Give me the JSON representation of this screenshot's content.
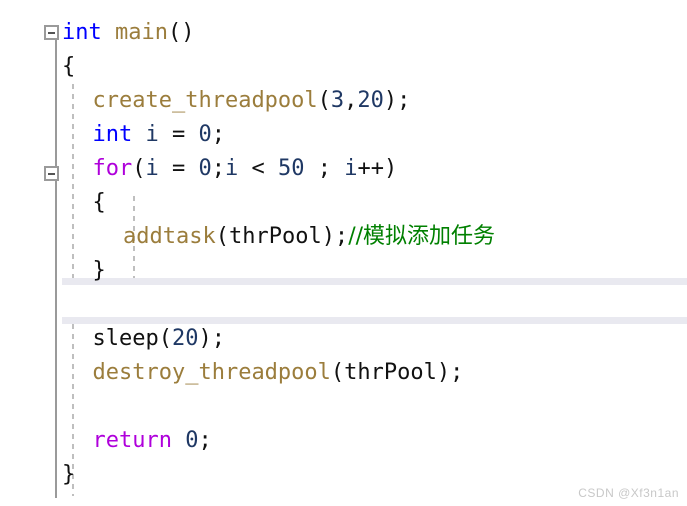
{
  "editor": {
    "language": "C",
    "background": "#ffffff",
    "font_size_px": 22,
    "line_height_px": 34
  },
  "colors": {
    "keyword": "#0000ff",
    "control": "#af00db",
    "function": "#9b7d3c",
    "variable": "#1f3864",
    "number": "#1f3864",
    "punctuation": "#111111",
    "comment": "#008000",
    "gutter_line": "#9a9a9a",
    "indent_guide": "#bfbfbf",
    "current_line_border": "#e9e9f0",
    "watermark": "#c8c8c8"
  },
  "fold_markers": [
    {
      "name": "fold-main",
      "line": 0,
      "state": "expanded",
      "glyph": "minus"
    },
    {
      "name": "fold-for",
      "line": 4,
      "state": "expanded",
      "glyph": "minus"
    }
  ],
  "current_line_index": 8,
  "lines": [
    {
      "index": 0,
      "text": "int main()",
      "tokens": [
        {
          "t": "int",
          "c": "kw"
        },
        {
          "t": " ",
          "c": "plain"
        },
        {
          "t": "main",
          "c": "fn"
        },
        {
          "t": "()",
          "c": "punct"
        }
      ]
    },
    {
      "index": 1,
      "text": "{",
      "tokens": [
        {
          "t": "{",
          "c": "punct"
        }
      ]
    },
    {
      "index": 2,
      "text": "    create_threadpool(3,20);",
      "tokens": [
        {
          "t": "create_threadpool",
          "c": "fn"
        },
        {
          "t": "(",
          "c": "punct"
        },
        {
          "t": "3",
          "c": "num"
        },
        {
          "t": ",",
          "c": "punct"
        },
        {
          "t": "20",
          "c": "num"
        },
        {
          "t": ");",
          "c": "punct"
        }
      ]
    },
    {
      "index": 3,
      "text": "    int i = 0;",
      "tokens": [
        {
          "t": "int",
          "c": "kw"
        },
        {
          "t": " ",
          "c": "plain"
        },
        {
          "t": "i",
          "c": "var"
        },
        {
          "t": " = ",
          "c": "punct"
        },
        {
          "t": "0",
          "c": "num"
        },
        {
          "t": ";",
          "c": "punct"
        }
      ]
    },
    {
      "index": 4,
      "text": "    for(i = 0;i < 50 ; i++)",
      "tokens": [
        {
          "t": "for",
          "c": "ctrl"
        },
        {
          "t": "(",
          "c": "punct"
        },
        {
          "t": "i",
          "c": "var"
        },
        {
          "t": " = ",
          "c": "punct"
        },
        {
          "t": "0",
          "c": "num"
        },
        {
          "t": ";",
          "c": "punct"
        },
        {
          "t": "i",
          "c": "var"
        },
        {
          "t": " < ",
          "c": "punct"
        },
        {
          "t": "50",
          "c": "num"
        },
        {
          "t": " ; ",
          "c": "punct"
        },
        {
          "t": "i",
          "c": "var"
        },
        {
          "t": "++)",
          "c": "punct"
        }
      ]
    },
    {
      "index": 5,
      "text": "    {",
      "tokens": [
        {
          "t": "{",
          "c": "punct"
        }
      ]
    },
    {
      "index": 6,
      "text": "        addtask(thrPool);//模拟添加任务",
      "tokens": [
        {
          "t": "addtask",
          "c": "fn"
        },
        {
          "t": "(",
          "c": "punct"
        },
        {
          "t": "thrPool",
          "c": "plain"
        },
        {
          "t": ");",
          "c": "punct"
        },
        {
          "t": "//模拟添加任务",
          "c": "comment"
        }
      ]
    },
    {
      "index": 7,
      "text": "    }",
      "tokens": [
        {
          "t": "}",
          "c": "punct"
        }
      ]
    },
    {
      "index": 8,
      "text": "",
      "tokens": []
    },
    {
      "index": 9,
      "text": "    sleep(20);",
      "tokens": [
        {
          "t": "sleep",
          "c": "plain"
        },
        {
          "t": "(",
          "c": "punct"
        },
        {
          "t": "20",
          "c": "num"
        },
        {
          "t": ");",
          "c": "punct"
        }
      ]
    },
    {
      "index": 10,
      "text": "    destroy_threadpool(thrPool);",
      "tokens": [
        {
          "t": "destroy_threadpool",
          "c": "fn"
        },
        {
          "t": "(",
          "c": "punct"
        },
        {
          "t": "thrPool",
          "c": "plain"
        },
        {
          "t": ");",
          "c": "punct"
        }
      ]
    },
    {
      "index": 11,
      "text": "",
      "tokens": []
    },
    {
      "index": 12,
      "text": "    return 0;",
      "tokens": [
        {
          "t": "return",
          "c": "ctrl"
        },
        {
          "t": " ",
          "c": "plain"
        },
        {
          "t": "0",
          "c": "num"
        },
        {
          "t": ";",
          "c": "punct"
        }
      ]
    },
    {
      "index": 13,
      "text": "}",
      "tokens": [
        {
          "t": "}",
          "c": "punct"
        }
      ]
    }
  ],
  "watermark": {
    "text": "CSDN @Xf3n1an"
  }
}
